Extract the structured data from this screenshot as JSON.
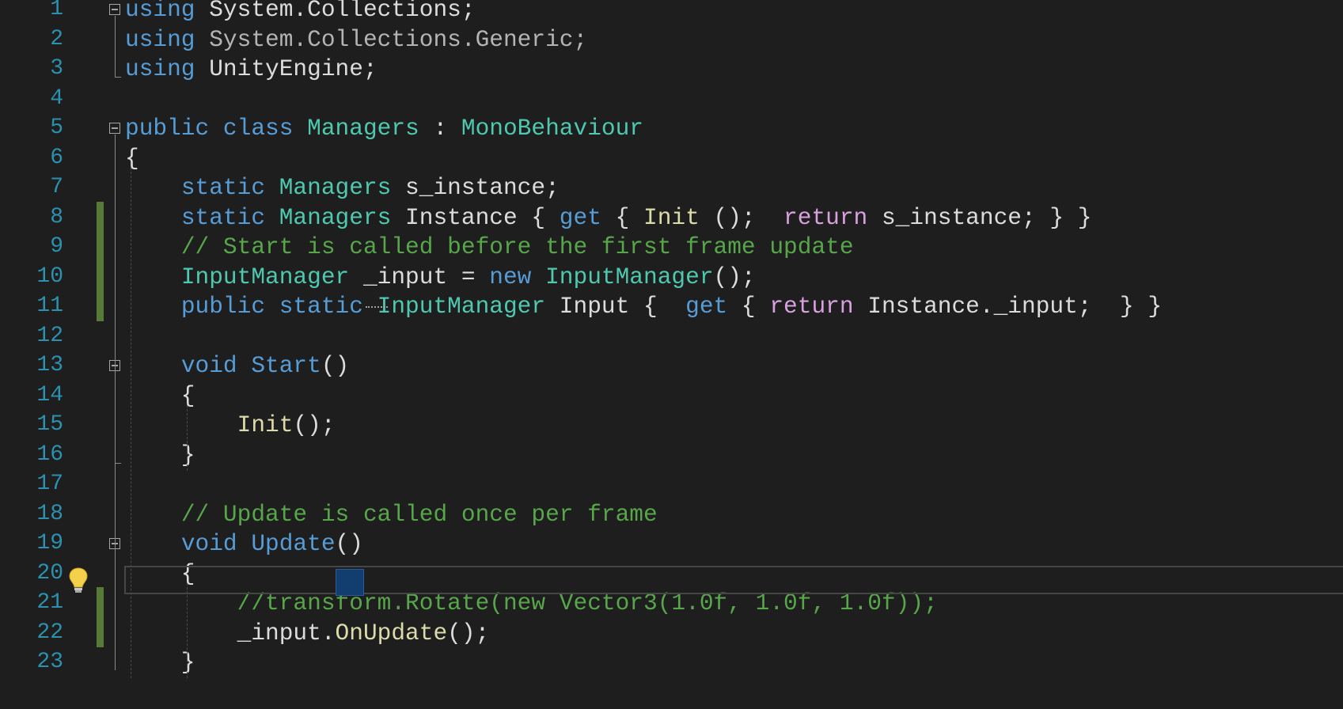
{
  "editor": {
    "colors": {
      "background": "#1e1e1e",
      "keyword": "#569cd6",
      "type": "#4ec9b0",
      "comment": "#57a64a",
      "control": "#d8a0df",
      "method": "#dcdcaa",
      "line_number": "#2b91af",
      "change_bar": "#577a37"
    },
    "lines": [
      {
        "num": "1",
        "tokens": [
          {
            "t": "using",
            "c": "kw"
          },
          {
            "t": " System.Collections;",
            "c": "pl"
          }
        ]
      },
      {
        "num": "2",
        "tokens": [
          {
            "t": "using",
            "c": "kw"
          },
          {
            "t": " System.Collections.Generic;",
            "c": "dim"
          }
        ]
      },
      {
        "num": "3",
        "tokens": [
          {
            "t": "using",
            "c": "kw"
          },
          {
            "t": " UnityEngine;",
            "c": "pl"
          }
        ]
      },
      {
        "num": "4",
        "tokens": []
      },
      {
        "num": "5",
        "tokens": [
          {
            "t": "public",
            "c": "kw"
          },
          {
            "t": " ",
            "c": "pl"
          },
          {
            "t": "class",
            "c": "kw"
          },
          {
            "t": " ",
            "c": "pl"
          },
          {
            "t": "Managers",
            "c": "ty"
          },
          {
            "t": " : ",
            "c": "pl"
          },
          {
            "t": "MonoBehaviour",
            "c": "ty"
          }
        ]
      },
      {
        "num": "6",
        "tokens": [
          {
            "t": "{",
            "c": "pl"
          }
        ]
      },
      {
        "num": "7",
        "tokens": [
          {
            "t": "    ",
            "c": "pl"
          },
          {
            "t": "static",
            "c": "kw"
          },
          {
            "t": " ",
            "c": "pl"
          },
          {
            "t": "Managers",
            "c": "ty"
          },
          {
            "t": " s_instance;",
            "c": "pl"
          }
        ]
      },
      {
        "num": "8",
        "tokens": [
          {
            "t": "    ",
            "c": "pl"
          },
          {
            "t": "static",
            "c": "kw"
          },
          {
            "t": " ",
            "c": "pl"
          },
          {
            "t": "Managers",
            "c": "ty"
          },
          {
            "t": " Instance { ",
            "c": "pl"
          },
          {
            "t": "get",
            "c": "kw"
          },
          {
            "t": " { ",
            "c": "pl"
          },
          {
            "t": "Init",
            "c": "fn"
          },
          {
            "t": " ();  ",
            "c": "pl"
          },
          {
            "t": "return",
            "c": "ct"
          },
          {
            "t": " s_instance; } }",
            "c": "pl"
          }
        ]
      },
      {
        "num": "9",
        "tokens": [
          {
            "t": "    ",
            "c": "pl"
          },
          {
            "t": "// Start is called before the first frame update",
            "c": "cm"
          }
        ]
      },
      {
        "num": "10",
        "tokens": [
          {
            "t": "    ",
            "c": "pl"
          },
          {
            "t": "InputManager",
            "c": "ty"
          },
          {
            "t": " _input = ",
            "c": "pl"
          },
          {
            "t": "new",
            "c": "kw"
          },
          {
            "t": " ",
            "c": "pl"
          },
          {
            "t": "InputManager",
            "c": "ty"
          },
          {
            "t": "();",
            "c": "pl"
          }
        ]
      },
      {
        "num": "11",
        "tokens": [
          {
            "t": "    ",
            "c": "pl"
          },
          {
            "t": "public",
            "c": "kw"
          },
          {
            "t": " ",
            "c": "pl"
          },
          {
            "t": "static",
            "c": "kw"
          },
          {
            "t": " ",
            "c": "pl"
          },
          {
            "t": "InputManager",
            "c": "ty"
          },
          {
            "t": " Input {  ",
            "c": "pl"
          },
          {
            "t": "get",
            "c": "kw"
          },
          {
            "t": " { ",
            "c": "pl"
          },
          {
            "t": "return",
            "c": "ct"
          },
          {
            "t": " Instance._input;  } }",
            "c": "pl"
          }
        ]
      },
      {
        "num": "12",
        "tokens": []
      },
      {
        "num": "13",
        "tokens": [
          {
            "t": "    ",
            "c": "pl"
          },
          {
            "t": "void",
            "c": "kw"
          },
          {
            "t": " ",
            "c": "pl"
          },
          {
            "t": "Start",
            "c": "kw"
          },
          {
            "t": "()",
            "c": "pl"
          }
        ]
      },
      {
        "num": "14",
        "tokens": [
          {
            "t": "    {",
            "c": "pl"
          }
        ]
      },
      {
        "num": "15",
        "tokens": [
          {
            "t": "        ",
            "c": "pl"
          },
          {
            "t": "Init",
            "c": "fn"
          },
          {
            "t": "();",
            "c": "pl"
          }
        ]
      },
      {
        "num": "16",
        "tokens": [
          {
            "t": "    }",
            "c": "pl"
          }
        ]
      },
      {
        "num": "17",
        "tokens": []
      },
      {
        "num": "18",
        "tokens": [
          {
            "t": "    ",
            "c": "pl"
          },
          {
            "t": "// Update is called once per frame",
            "c": "cm"
          }
        ]
      },
      {
        "num": "19",
        "tokens": [
          {
            "t": "    ",
            "c": "pl"
          },
          {
            "t": "void",
            "c": "kw"
          },
          {
            "t": " ",
            "c": "pl"
          },
          {
            "t": "Update",
            "c": "kw"
          },
          {
            "t": "()",
            "c": "pl"
          }
        ]
      },
      {
        "num": "20",
        "tokens": [
          {
            "t": "    {",
            "c": "pl"
          }
        ]
      },
      {
        "num": "21",
        "tokens": [
          {
            "t": "        ",
            "c": "pl"
          },
          {
            "t": "//transform.Rotate(new Vector3(1.0f, 1.0f, 1.0f));",
            "c": "cm"
          }
        ]
      },
      {
        "num": "22",
        "tokens": [
          {
            "t": "        ",
            "c": "pl"
          },
          {
            "t": "_input.",
            "c": "pl"
          },
          {
            "t": "OnUpdate",
            "c": "fn"
          },
          {
            "t": "();",
            "c": "pl"
          }
        ]
      },
      {
        "num": "23",
        "tokens": [
          {
            "t": "    }",
            "c": "pl"
          }
        ]
      }
    ],
    "changed_lines": [
      "8",
      "9",
      "10",
      "11",
      "21",
      "22"
    ],
    "fold_markers": [
      "1",
      "5",
      "13",
      "19"
    ],
    "current_line": "19",
    "lightbulb_icon": "lightbulb-icon"
  }
}
